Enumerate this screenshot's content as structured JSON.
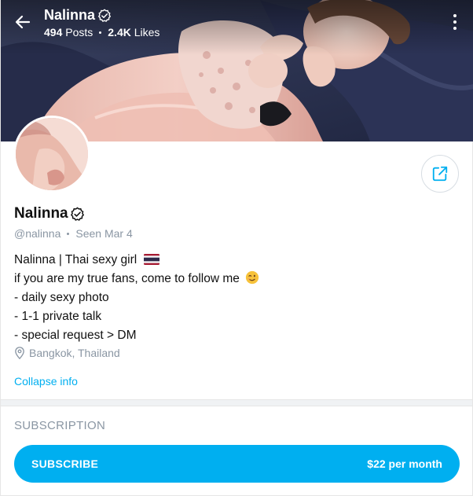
{
  "header": {
    "name": "Nalinna",
    "posts_count": "494",
    "posts_label": "Posts",
    "likes_count": "2.4K",
    "likes_label": "Likes"
  },
  "profile": {
    "name": "Nalinna",
    "handle": "@nalinna",
    "seen": "Seen Mar 4",
    "bio_lines": [
      "Nalinna | Thai sexy girl",
      "if you are my true fans, come to follow me",
      "- daily sexy photo",
      "- 1-1 private talk",
      "- special request > DM"
    ],
    "location": "Bangkok, Thailand",
    "collapse_label": "Collapse info"
  },
  "subscription": {
    "section_title": "SUBSCRIPTION",
    "button_label": "SUBSCRIBE",
    "price": "$22 per month"
  },
  "colors": {
    "accent": "#00aff0",
    "muted": "#8a96a3"
  },
  "icons": [
    "back-arrow-icon",
    "verified-icon",
    "more-vertical-icon",
    "share-icon",
    "location-pin-icon",
    "thai-flag-emoji",
    "wink-emoji"
  ]
}
